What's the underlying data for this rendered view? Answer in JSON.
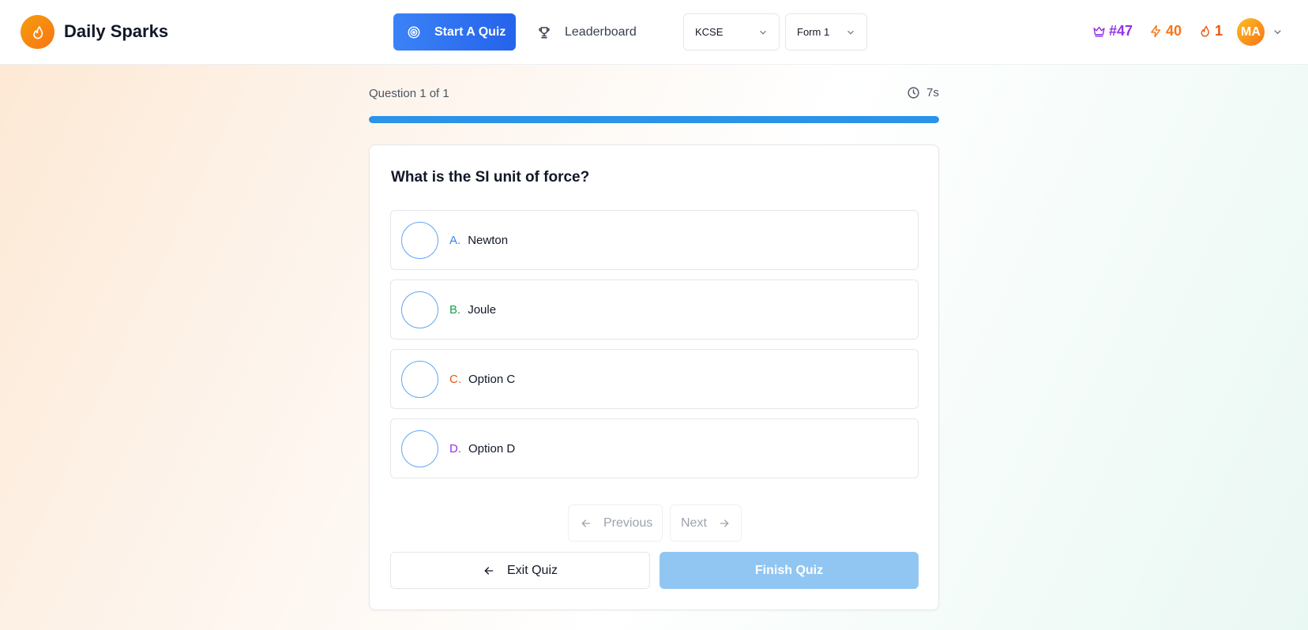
{
  "header": {
    "brand": "Daily Sparks",
    "logo_icon": "flame-icon",
    "start_quiz_label": "Start A Quiz",
    "leaderboard_label": "Leaderboard",
    "exam_select": {
      "value": "KCSE"
    },
    "form_select": {
      "value": "Form 1"
    },
    "stats": {
      "rank": "#47",
      "xp": "40",
      "streak": "1"
    },
    "avatar_initials": "MA"
  },
  "quiz": {
    "counter": "Question 1 of 1",
    "timer": "7s",
    "progress": 1.0,
    "question": "What is the SI unit of force?",
    "options": [
      {
        "letter": "A.",
        "text": "Newton",
        "color": "#3b82f6"
      },
      {
        "letter": "B.",
        "text": "Joule",
        "color": "#16a34a"
      },
      {
        "letter": "C.",
        "text": "Option C",
        "color": "#ea580c"
      },
      {
        "letter": "D.",
        "text": "Option D",
        "color": "#9333ea"
      }
    ],
    "previous_label": "Previous",
    "next_label": "Next",
    "exit_label": "Exit Quiz",
    "finish_label": "Finish Quiz"
  },
  "colors": {
    "primary": "#2563eb",
    "progress": "#2b93e8",
    "rank": "#9333ea",
    "xp": "#f97316",
    "finish_disabled": "#91c6f2"
  }
}
